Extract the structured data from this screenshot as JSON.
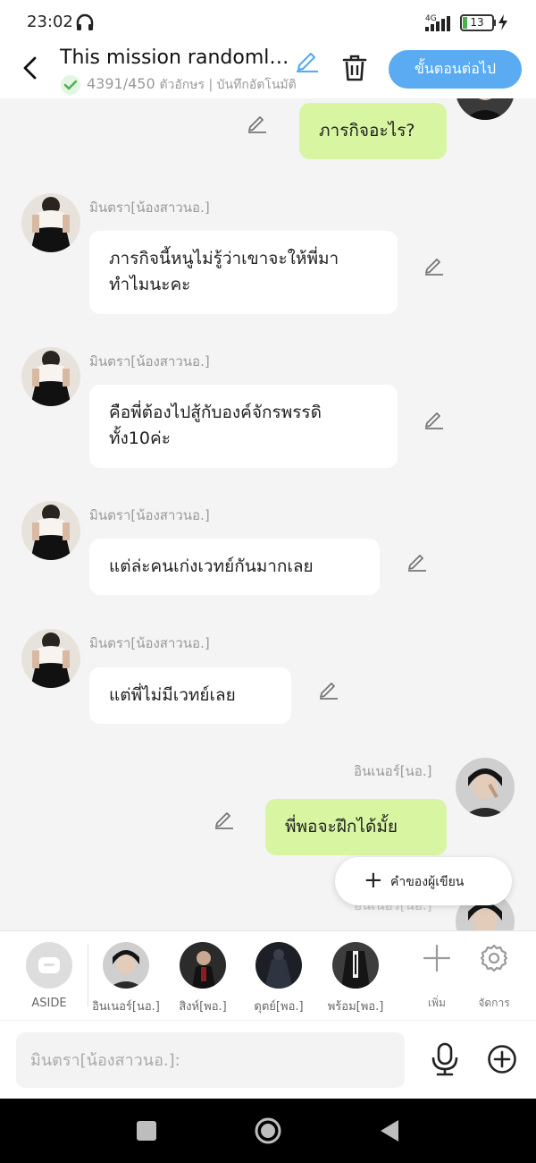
{
  "status": {
    "time": "23:02",
    "network": "4G",
    "battery": "13"
  },
  "header": {
    "title": "This mission randomly...",
    "count": "4391/450",
    "count_suffix": "ตัวอักษร | บันทึกอัตโนมัติ",
    "next_label": "ขั้นตอนต่อไป"
  },
  "messages": [
    {
      "side": "right",
      "text": "ภารกิจอะไร?"
    },
    {
      "side": "left",
      "name": "มินตรา[น้องสาวนอ.]",
      "text": "ภารกิจนี้หนูไม่รู้ว่าเขาจะให้พี่มาทำไมนะคะ"
    },
    {
      "side": "left",
      "name": "มินตรา[น้องสาวนอ.]",
      "text": "คือพี่ต้องไปสู้กับองค์จักรพรรดิทั้ง10ค่ะ"
    },
    {
      "side": "left",
      "name": "มินตรา[น้องสาวนอ.]",
      "text": "แต่ล่ะคนเก่งเวทย์กันมากเลย"
    },
    {
      "side": "left",
      "name": "มินตรา[น้องสาวนอ.]",
      "text": "แต่พี่ไม่มีเวทย์เลย"
    },
    {
      "side": "right",
      "name": "อินเนอร์[นอ.]",
      "text": "พี่พอจะฝึกได้มั้ย"
    }
  ],
  "author_note_label": "คำของผู้เขียน",
  "characters": [
    {
      "label": "ASIDE",
      "icon": "aside-icon"
    },
    {
      "label": "อินเนอร์[นอ.]"
    },
    {
      "label": "สิงห์[พอ.]"
    },
    {
      "label": "ดุตย์[พอ.]"
    },
    {
      "label": "พร้อม[พอ.]"
    }
  ],
  "tools": {
    "add_label": "เพิ่ม",
    "manage_label": "จัดการ"
  },
  "input": {
    "placeholder": "มินตรา[น้องสาวนอ.]:"
  },
  "colors": {
    "accent": "#5aabf2",
    "bubble_right": "#d8f5a2",
    "bubble_left": "#ffffff"
  }
}
